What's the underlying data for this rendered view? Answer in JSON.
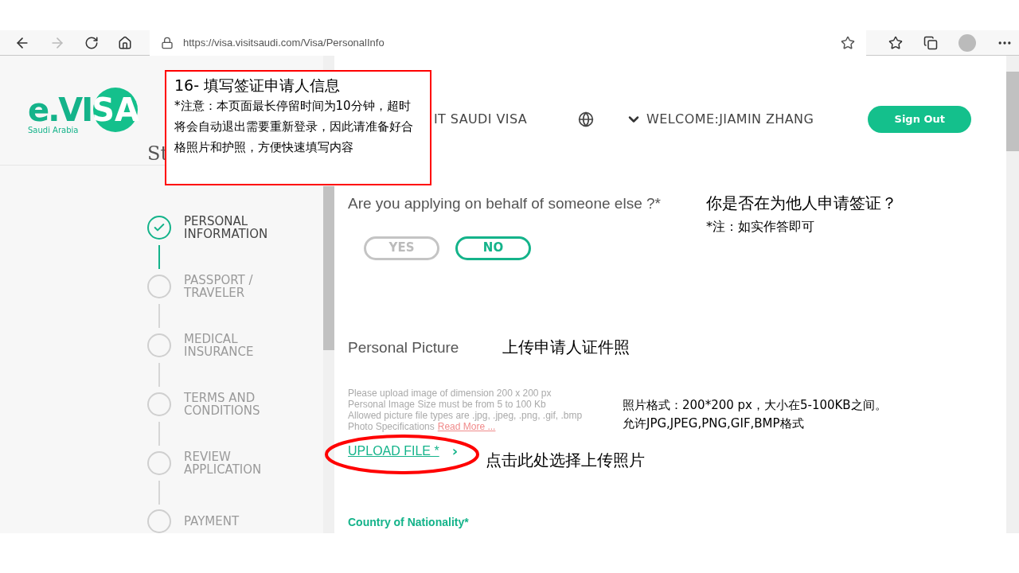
{
  "browser": {
    "url": "https://visa.visitsaudi.com/Visa/PersonalInfo"
  },
  "logo": {
    "lead": "e.VI",
    "tail": "SA",
    "subtitle": "Saudi Arabia"
  },
  "left_heading": "St",
  "header": {
    "site_title": "IT SAUDI VISA",
    "welcome": "WELCOME:JIAMIN ZHANG",
    "sign_out": "Sign Out"
  },
  "steps": [
    {
      "label": "PERSONAL INFORMATION",
      "completed": true
    },
    {
      "label": "PASSPORT / TRAVELER",
      "completed": false
    },
    {
      "label": "MEDICAL INSURANCE",
      "completed": false
    },
    {
      "label": "TERMS AND CONDITIONS",
      "completed": false
    },
    {
      "label": "REVIEW APPLICATION",
      "completed": false
    },
    {
      "label": "PAYMENT",
      "completed": false
    }
  ],
  "form": {
    "question": "Are you applying on behalf of someone else ?*",
    "options": [
      {
        "label": "YES",
        "selected": false
      },
      {
        "label": "NO",
        "selected": true
      }
    ],
    "picture_heading": "Personal Picture",
    "help_lines": [
      "Please upload image of dimension 200 x 200 px",
      "Personal Image Size must be from 5 to 100 Kb",
      "Allowed picture file types are .jpg, .jpeg, .png, .gif, .bmp"
    ],
    "spec_label": "Photo Specifications",
    "read_more": "Read More ...",
    "upload": "UPLOAD FILE *",
    "upload_arrow": "›",
    "nationality_label": "Country of Nationality*"
  },
  "annotations": {
    "title": "16- 填写签证申请人信息",
    "note": "*注意：本页面最长停留时间为10分钟，超时将会自动退出需要重新登录，因此请准备好合格照片和护照，方便快速填写内容",
    "question_cn": "你是否在为他人申请签证？",
    "question_note": "*注：如实作答即可",
    "picture_cn": "上传申请人证件照",
    "format_cn": "照片格式：200*200 px，大小在5-100KB之间。允许JPG,JPEG,PNG,GIF,BMP格式",
    "upload_cn": "点击此处选择上传照片"
  }
}
